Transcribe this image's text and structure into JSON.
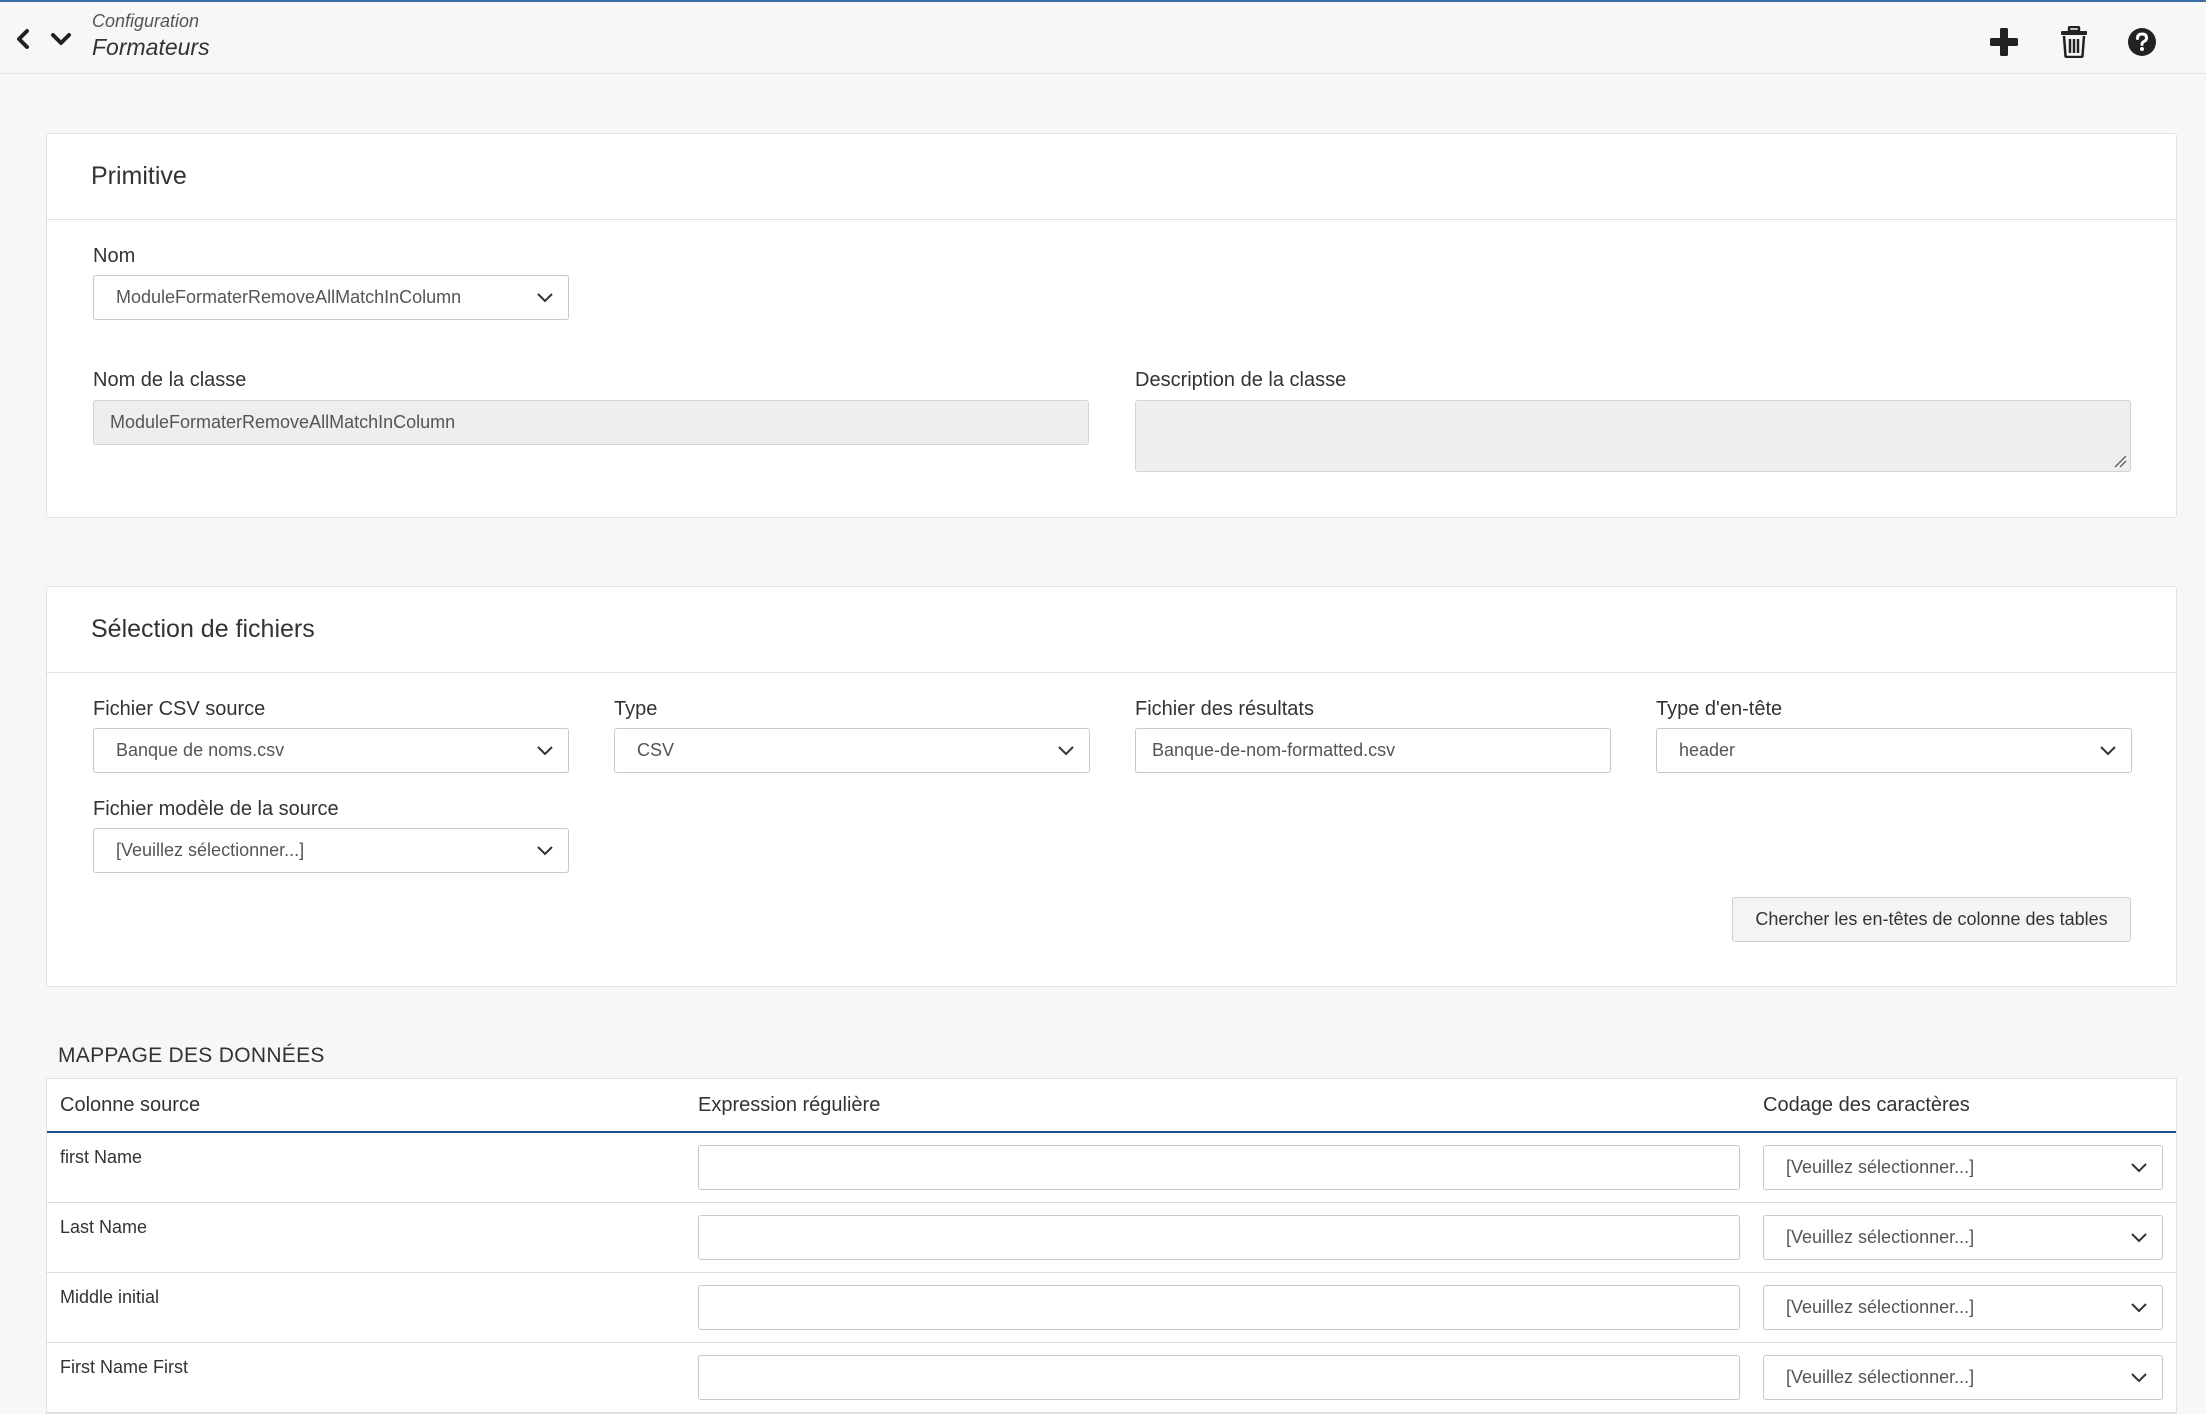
{
  "header": {
    "breadcrumb_parent": "Configuration",
    "breadcrumb_title": "Formateurs",
    "back_icon": "chevron-left-icon",
    "down_icon": "chevron-down-icon",
    "add_icon": "plus-icon",
    "delete_icon": "trash-icon",
    "help_icon": "question-circle-icon"
  },
  "primitive": {
    "title": "Primitive",
    "nom_label": "Nom",
    "nom_value": "ModuleFormaterRemoveAllMatchInColumn",
    "class_label": "Nom de la classe",
    "class_value": "ModuleFormaterRemoveAllMatchInColumn",
    "description_label": "Description de la classe",
    "description_value": ""
  },
  "files": {
    "title": "Sélection de fichiers",
    "source_label": "Fichier CSV source",
    "source_value": "Banque de noms.csv",
    "type_label": "Type",
    "type_value": "CSV",
    "result_label": "Fichier des résultats",
    "result_value": "Banque-de-nom-formatted.csv",
    "header_type_label": "Type d'en-tête",
    "header_type_value": "header",
    "model_label": "Fichier modèle de la source",
    "model_value": "[Veuillez sélectionner...]",
    "search_button": "Chercher les en-têtes de colonne des tables"
  },
  "mapping": {
    "title": "MAPPAGE DES DONNÉES",
    "columns": [
      "Colonne source",
      "Expression régulière",
      "Codage des caractères"
    ],
    "rows": [
      {
        "source": "first Name",
        "regex": "",
        "encoding": "[Veuillez sélectionner...]"
      },
      {
        "source": "Last Name",
        "regex": "",
        "encoding": "[Veuillez sélectionner...]"
      },
      {
        "source": "Middle initial",
        "regex": "",
        "encoding": "[Veuillez sélectionner...]"
      },
      {
        "source": "First Name First",
        "regex": "",
        "encoding": "[Veuillez sélectionner...]"
      }
    ]
  },
  "colors": {
    "accent": "#1f4f8a",
    "topbar_border": "#3a6ea5",
    "background": "#f7f7f7"
  }
}
